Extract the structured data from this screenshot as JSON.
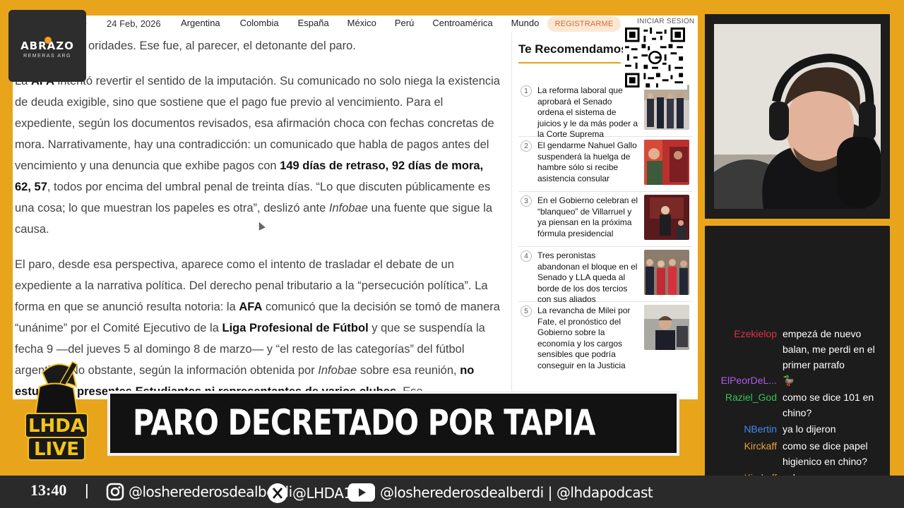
{
  "navbar": {
    "logo_fragment": "e",
    "date": "24 Feb, 2026",
    "links": [
      "Argentina",
      "Colombia",
      "España",
      "México",
      "Perú",
      "Centroamérica",
      "Mundo"
    ],
    "register_label": "REGISTRARME",
    "login_label": "INICIAR SESION"
  },
  "article": {
    "p1_line1": "oridades. Ese fue, al parecer, el detonante del paro.",
    "p2_a": "La ",
    "p2_afa": "AFA",
    "p2_b": " intentó revertir el sentido de la imputación. Su comunicado no solo niega la existencia de deuda exigible, sino que sostiene que el pago fue previo al vencimiento. Para el expediente, según los documentos revisados, esa afirmación choca con fechas concretas de mora. Narrativamente, hay una contradicción: un comunicado que habla de pagos antes del vencimiento y una denuncia que exhibe pagos con ",
    "p2_bold": "149 días de retraso, 92 días de mora, 62, 57",
    "p2_c": ", todos por encima del umbral penal de treinta días. “Lo que discuten públicamente es una cosa; lo que muestran los papeles es otra”, deslizó ante ",
    "p2_infobae": "Infobae",
    "p2_d": " una fuente que sigue la causa.",
    "p3_a": "El paro, desde esa perspectiva, aparece como el intento de trasladar el debate de un expediente a la narrativa política. Del derecho penal tributario a la “persecución política”. La forma en que se anunció resulta notoria: la ",
    "p3_afa": "AFA",
    "p3_b": " comunicó que la decisión se tomó de manera “unánime” por el Comité Ejecutivo de la ",
    "p3_liga": "Liga Profesional de Fútbol",
    "p3_c": " y que se suspendía la fecha 9 —del jueves 5 al domingo 8 de marzo— y “el resto de las categorías” del fútbol argentino. No obstante, según la información obtenida por ",
    "p3_infobae": "Infobae",
    "p3_d": " sobre esa reunión, ",
    "p3_bold": "no estuvieron presentes Estudiantes ni representantes de varios clubes",
    "p3_e": ". Ese"
  },
  "sidebar": {
    "title": "Te Recomendamos",
    "items": [
      {
        "num": "1",
        "text": "La reforma laboral que aprobará el Senado ordena el sistema de juicios y le da más poder a la Corte Suprema"
      },
      {
        "num": "2",
        "text": "El gendarme Nahuel Gallo suspenderá la huelga de hambre sólo si recibe asistencia consular"
      },
      {
        "num": "3",
        "text": "En el Gobierno celebran el “blanqueo” de Villarruel y ya piensan en la próxima fórmula presidencial"
      },
      {
        "num": "4",
        "text": "Tres peronistas abandonan el bloque en el Senado y LLA queda al borde de los dos tercios con sus aliados"
      },
      {
        "num": "5",
        "text": "La revancha de Milei por Fate, el pronóstico del Gobierno sobre la economía y los cargos sensibles que podría conseguir en la Justicia"
      }
    ]
  },
  "brand": {
    "logo_main": "ABRAZO",
    "logo_sub": "REMERAS ARG",
    "lhda_line1": "LHDA",
    "lhda_line2": "LIVE"
  },
  "headline": "PARO DECRETADO POR TAPIA",
  "chat": [
    {
      "user": "Ezekielop",
      "color": "#e0304a",
      "text": "empezá de nuevo balan, me perdi en el primer parrafo"
    },
    {
      "user": "ElPeorDeL...",
      "color": "#b05ce6",
      "text": "🦆"
    },
    {
      "user": "Raziel_God",
      "color": "#36c254",
      "text": "como se dice 101 en chino?"
    },
    {
      "user": "NBertin",
      "color": "#3f8cf0",
      "text": "ya lo dijeron"
    },
    {
      "user": "Kirckaff",
      "color": "#e8a040",
      "text": "como se dice papel higienico en chino?"
    },
    {
      "user": "Kirckaff",
      "color": "#e8a040",
      "text": "sakacaca"
    }
  ],
  "bottom_bar": {
    "time": "13:40",
    "instagram": "@losherederosdealberdi",
    "x": "@LHDA16",
    "youtube": "@losherederosdealberdi",
    "podcast": "@lhdapodcast",
    "separator": "|"
  },
  "icons": {
    "instagram": "instagram-icon",
    "x": "x-logo-icon",
    "youtube": "youtube-icon"
  }
}
